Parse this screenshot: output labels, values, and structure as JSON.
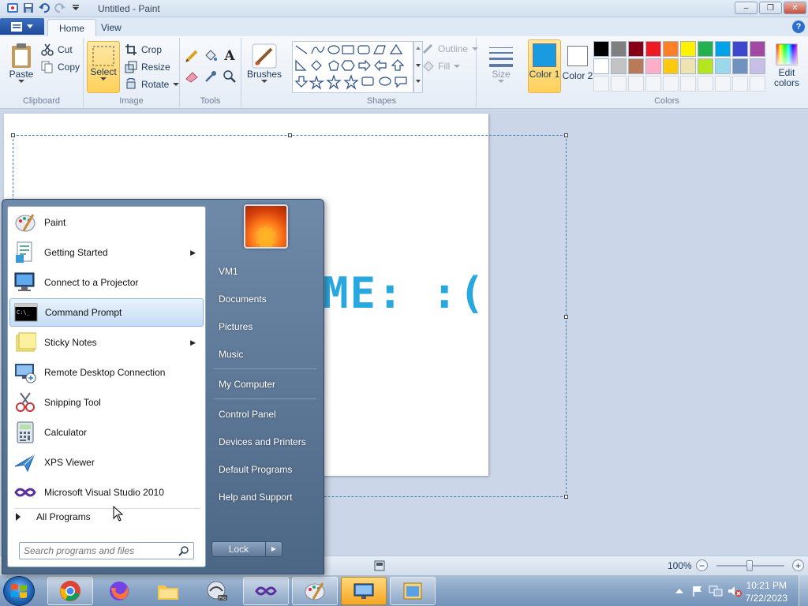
{
  "window": {
    "title": "Untitled - Paint",
    "controls": {
      "minimize": "–",
      "restore": "❐",
      "close": "✕"
    }
  },
  "ribbon": {
    "tabs": [
      {
        "label": "Home",
        "active": true
      },
      {
        "label": "View",
        "active": false
      }
    ],
    "help": "?",
    "clipboard": {
      "label": "Clipboard",
      "paste": "Paste",
      "cut": "Cut",
      "copy": "Copy"
    },
    "image": {
      "label": "Image",
      "select": "Select",
      "crop": "Crop",
      "resize": "Resize",
      "rotate": "Rotate"
    },
    "tools": {
      "label": "Tools"
    },
    "brushes": {
      "label": "Brushes"
    },
    "shapes": {
      "label": "Shapes",
      "outline": "Outline",
      "fill": "Fill"
    },
    "size": {
      "label": "Size"
    },
    "colors": {
      "label": "Colors",
      "color1": "Color 1",
      "color2": "Color 2",
      "edit": "Edit colors",
      "color1_value": "#1a9be0",
      "color2_value": "#ffffff",
      "palette_row1": [
        "#000000",
        "#7f7f7f",
        "#880015",
        "#ed1c24",
        "#ff7f27",
        "#fff200",
        "#22b14c",
        "#00a2e8",
        "#3f48cc",
        "#a349a4"
      ],
      "palette_row2": [
        "#ffffff",
        "#c3c3c3",
        "#b97a57",
        "#ffaec9",
        "#ffc90e",
        "#efe4b0",
        "#b5e61d",
        "#99d9ea",
        "#7092be",
        "#c8bfe7"
      ]
    }
  },
  "canvas": {
    "text": "ME: :("
  },
  "statusbar": {
    "zoom": "100%"
  },
  "start_menu": {
    "pinned": [
      {
        "label": "Paint",
        "icon": "paint-icon",
        "submenu": false
      },
      {
        "label": "Getting Started",
        "icon": "getting-started-icon",
        "submenu": true
      },
      {
        "label": "Connect to a Projector",
        "icon": "projector-icon",
        "submenu": false
      },
      {
        "label": "Command Prompt",
        "icon": "command-prompt-icon",
        "submenu": false,
        "hover": true
      },
      {
        "label": "Sticky Notes",
        "icon": "sticky-notes-icon",
        "submenu": true
      },
      {
        "label": "Remote Desktop Connection",
        "icon": "remote-desktop-icon",
        "submenu": false
      },
      {
        "label": "Snipping Tool",
        "icon": "snipping-tool-icon",
        "submenu": false
      },
      {
        "label": "Calculator",
        "icon": "calculator-icon",
        "submenu": false
      },
      {
        "label": "XPS Viewer",
        "icon": "xps-viewer-icon",
        "submenu": false
      },
      {
        "label": "Microsoft Visual Studio 2010",
        "icon": "visual-studio-icon",
        "submenu": false
      }
    ],
    "all_programs": "All Programs",
    "search_placeholder": "Search programs and files",
    "right_items": [
      {
        "label": "VM1"
      },
      {
        "label": "Documents"
      },
      {
        "label": "Pictures"
      },
      {
        "label": "Music"
      },
      {
        "label": "My Computer"
      },
      {
        "label": "Control Panel"
      },
      {
        "label": "Devices and Printers"
      },
      {
        "label": "Default Programs"
      },
      {
        "label": "Help and Support"
      }
    ],
    "lock": "Lock"
  },
  "taskbar": {
    "apps": [
      "Google Chrome",
      "Firefox",
      "Windows Explorer",
      "Paint.NET Pro",
      "Visual Studio",
      "Paint",
      "Remote Desktop",
      "Window"
    ],
    "clock": {
      "time": "10:21 PM",
      "date": "7/22/2023"
    }
  }
}
